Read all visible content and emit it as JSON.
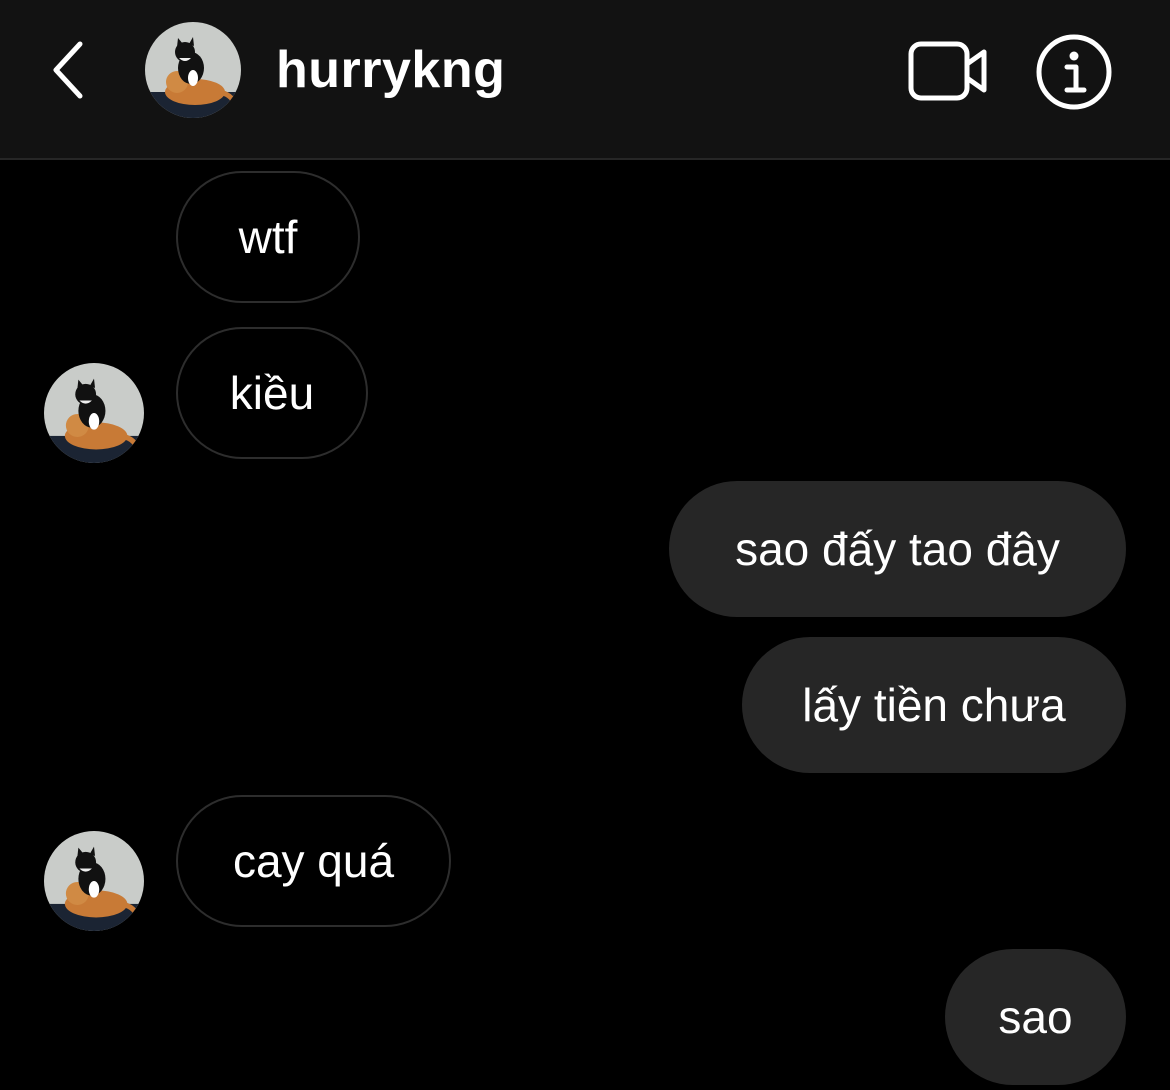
{
  "header": {
    "username": "hurrykng",
    "icons": {
      "back": "chevron-left-icon",
      "video": "video-camera-icon",
      "info": "info-icon"
    }
  },
  "messages": [
    {
      "direction": "received",
      "text": "wtf",
      "show_avatar": false
    },
    {
      "direction": "received",
      "text": "kiều",
      "show_avatar": true
    },
    {
      "direction": "sent",
      "text": "sao đấy tao đây"
    },
    {
      "direction": "sent",
      "text": "lấy tiền chưa"
    },
    {
      "direction": "received",
      "text": "cay quá",
      "show_avatar": true
    },
    {
      "direction": "sent",
      "text": "sao"
    }
  ],
  "colors": {
    "background": "#000000",
    "header_background": "#121212",
    "sent_bubble": "#262626",
    "received_bubble_border": "#2d2d2d",
    "text": "#ffffff"
  }
}
